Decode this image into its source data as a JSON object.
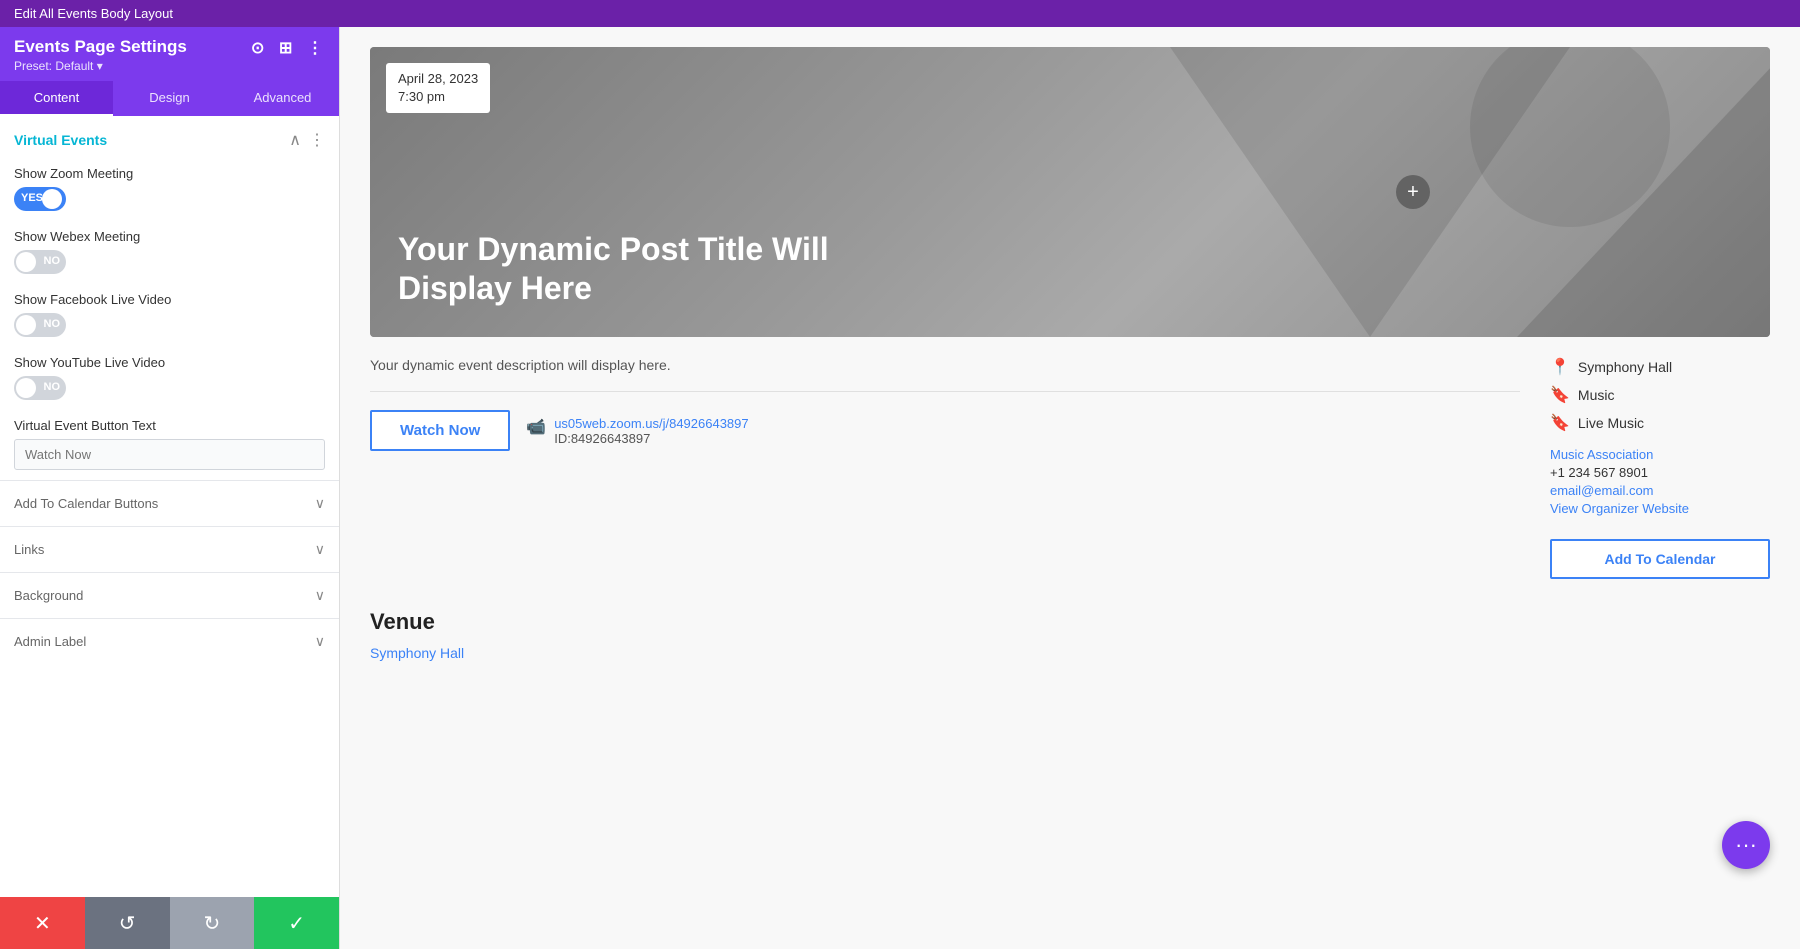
{
  "topBar": {
    "title": "Edit All Events Body Layout"
  },
  "sidebar": {
    "header": {
      "title": "Events Page Settings",
      "preset": "Preset: Default ▾"
    },
    "tabs": [
      {
        "label": "Content",
        "active": true
      },
      {
        "label": "Design",
        "active": false
      },
      {
        "label": "Advanced",
        "active": false
      }
    ],
    "virtualEvents": {
      "sectionTitle": "Virtual Events",
      "showZoomMeeting": {
        "label": "Show Zoom Meeting",
        "state": "on",
        "onText": "YES",
        "offText": "NO"
      },
      "showWebexMeeting": {
        "label": "Show Webex Meeting",
        "state": "off",
        "onText": "YES",
        "offText": "NO"
      },
      "showFacebookLiveVideo": {
        "label": "Show Facebook Live Video",
        "state": "off",
        "onText": "YES",
        "offText": "NO"
      },
      "showYoutubeLiveVideo": {
        "label": "Show YouTube Live Video",
        "state": "off",
        "onText": "YES",
        "offText": "NO"
      },
      "virtualEventButtonText": {
        "label": "Virtual Event Button Text",
        "placeholder": "Watch Now",
        "value": ""
      }
    },
    "collapsibleSections": [
      {
        "label": "Add To Calendar Buttons"
      },
      {
        "label": "Links"
      },
      {
        "label": "Background"
      },
      {
        "label": "Admin Label"
      }
    ]
  },
  "toolbar": {
    "closeLabel": "✕",
    "undoLabel": "↺",
    "redoLabel": "↻",
    "checkLabel": "✓"
  },
  "eventPreview": {
    "banner": {
      "date": "April 28, 2023",
      "time": "7:30 pm",
      "title": "Your Dynamic Post Title Will Display Here"
    },
    "description": "Your dynamic event description will display here.",
    "watchButtonLabel": "Watch Now",
    "zoomLink": "us05web.zoom.us/j/84926643897",
    "zoomId": "ID:84926643897",
    "venueName": "Symphony Hall",
    "categories": [
      {
        "label": "Music"
      },
      {
        "label": "Live Music"
      }
    ],
    "organizer": {
      "name": "Music Association",
      "phone": "+1 234 567 8901",
      "email": "email@email.com",
      "websiteLabel": "View Organizer Website"
    },
    "addCalendarLabel": "Add To Calendar",
    "venueSection": {
      "title": "Venue",
      "link": "Symphony Hall"
    }
  },
  "fab": {
    "icon": "···"
  }
}
